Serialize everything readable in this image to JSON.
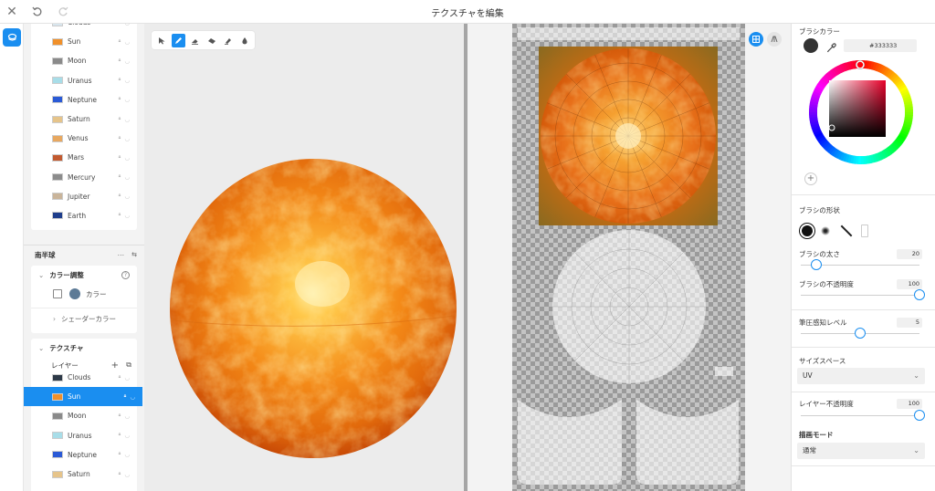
{
  "window": {
    "title": "テクスチャを編集"
  },
  "layers_top": [
    {
      "name": "Clouds",
      "color": "#d8e6ee"
    },
    {
      "name": "Sun",
      "color": "#f0902a"
    },
    {
      "name": "Moon",
      "color": "#8a8a8a"
    },
    {
      "name": "Uranus",
      "color": "#a8dde8"
    },
    {
      "name": "Neptune",
      "color": "#2a5ad6"
    },
    {
      "name": "Saturn",
      "color": "#e6c48a"
    },
    {
      "name": "Venus",
      "color": "#e8a860"
    },
    {
      "name": "Mars",
      "color": "#c25a30"
    },
    {
      "name": "Mercury",
      "color": "#8c8c8c"
    },
    {
      "name": "Jupiter",
      "color": "#c9b49a"
    },
    {
      "name": "Earth",
      "color": "#1e3e8c"
    }
  ],
  "object_section": {
    "title": "南半球"
  },
  "color_adjust": {
    "title": "カラー調整",
    "color_label": "カラー",
    "shader_label": "シェーダーカラー",
    "swatch": "#5c7a96"
  },
  "texture_section": {
    "title": "テクスチャ",
    "layers_label": "レイヤー"
  },
  "layers_bottom": [
    {
      "name": "Clouds",
      "color": "#2e3a48",
      "selected": false
    },
    {
      "name": "Sun",
      "color": "#f0902a",
      "selected": true
    },
    {
      "name": "Moon",
      "color": "#8a8a8a",
      "selected": false
    },
    {
      "name": "Uranus",
      "color": "#a8dde8",
      "selected": false
    },
    {
      "name": "Neptune",
      "color": "#2a5ad6",
      "selected": false
    },
    {
      "name": "Saturn",
      "color": "#e6c48a",
      "selected": false
    }
  ],
  "brush": {
    "color_title": "ブラシカラー",
    "hex": "#333333",
    "shape_title": "ブラシの形状",
    "size_label": "ブラシの太さ",
    "size_value": "20",
    "size_fraction": 0.13,
    "opacity_label": "ブラシの不透明度",
    "opacity_value": "100",
    "opacity_fraction": 1.0,
    "pressure_label": "筆圧感知レベル",
    "pressure_value": "5",
    "pressure_fraction": 0.5,
    "size_space_title": "サイズスペース",
    "size_space_value": "UV",
    "layer_opacity_label": "レイヤー不透明度",
    "layer_opacity_value": "100",
    "layer_opacity_fraction": 1.0,
    "blend_mode_title": "描画モード",
    "blend_mode_value": "通常"
  },
  "colors": {
    "accent": "#1a8ef0",
    "sun_core": "#ffd060",
    "sun_edge": "#d04a08"
  },
  "icons": [
    "close-icon",
    "undo-icon",
    "redo-icon",
    "layers-icon",
    "select-tool-icon",
    "brush-tool-icon",
    "eraser-tool-icon",
    "smudge-tool-icon",
    "fill-tool-icon",
    "blur-tool-icon",
    "eyedropper-icon",
    "add-swatch-icon",
    "uv-grid-icon",
    "uv-mesh-icon"
  ]
}
